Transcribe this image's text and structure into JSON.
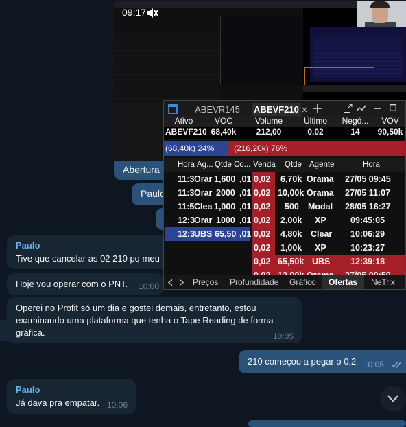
{
  "screenshot_thumb": {
    "time": "09:17"
  },
  "messages_out_partial": [
    {
      "text": "Abertura S"
    },
    {
      "text": "Paulo"
    }
  ],
  "messages": [
    {
      "sender": "Paulo",
      "lines": [
        "Tive que cancelar as 02 210 pq meu P"
      ]
    },
    {
      "lines": [
        "Hoje vou operar com o PNT."
      ],
      "time": "10:00"
    },
    {
      "lines": [
        "Operei no Profit só um dia e gostei demais, entretanto, estou",
        "examinando uma plataforma que tenha o Tape Reading de forma",
        "gráfica."
      ],
      "time": "10:05"
    },
    {
      "lines": [
        "210 começou a pegar o 0,2"
      ],
      "time": "10:05",
      "outgoing": true
    },
    {
      "sender": "Paulo",
      "lines": [
        "Já dava pra empatar."
      ],
      "time": "10:06"
    }
  ],
  "profit_window": {
    "tabs": [
      "ABEVR145",
      "ABEVF210"
    ],
    "active_tab": "ABEVF210",
    "quote_headers": [
      "Ativo",
      "VOC",
      "Volume",
      "Último",
      "Negó...",
      "VOV"
    ],
    "quote_values": [
      "ABEVF210",
      "68,40k",
      "212,00",
      "0,02",
      "14",
      "90,50k"
    ],
    "buy_bar": "(68,40k) 24%",
    "sell_bar": "(216,20k) 76%",
    "book_headers": [
      "Hora",
      "Ag...",
      "Qtde",
      "Co...",
      "Venda",
      "Qtde",
      "Agente",
      "Hora"
    ],
    "bid_rows": [
      {
        "hora": "11:3",
        "agente": "Orar",
        "qtde": "1,600",
        "preco": ",01"
      },
      {
        "hora": "11:3",
        "agente": "Orar",
        "qtde": "2000",
        "preco": ",01"
      },
      {
        "hora": "11:5",
        "agente": "Clea",
        "qtde": "1,000",
        "preco": ",01"
      },
      {
        "hora": "12:3",
        "agente": "Orar",
        "qtde": "1000",
        "preco": ",01"
      },
      {
        "hora": "12:3",
        "agente": "UBS",
        "qtde": "65,50",
        "preco": ",01"
      }
    ],
    "ask_rows": [
      {
        "venda": "0,02",
        "qtde": "6,70k",
        "agente": "Orama",
        "hora": "27/05 09:45"
      },
      {
        "venda": "0,02",
        "qtde": "10,00k",
        "agente": "Orama",
        "hora": "27/05 11:07"
      },
      {
        "venda": "0,02",
        "qtde": "500",
        "agente": "Modal",
        "hora": "28/05 16:27"
      },
      {
        "venda": "0,02",
        "qtde": "2,00k",
        "agente": "XP",
        "hora": "09:45:05"
      },
      {
        "venda": "0,02",
        "qtde": "4,80k",
        "agente": "Clear",
        "hora": "10:06:29"
      },
      {
        "venda": "0,02",
        "qtde": "1,00k",
        "agente": "XP",
        "hora": "10:23:27"
      },
      {
        "venda": "0,02",
        "qtde": "65,50k",
        "agente": "UBS",
        "hora": "12:39:18"
      },
      {
        "venda": "0,02",
        "qtde": "12,90k",
        "agente": "Orama",
        "hora": "27/05 09:59"
      }
    ],
    "bottom_tabs": [
      "Preços",
      "Profundidade",
      "Gráfico",
      "Ofertas",
      "NeTrix"
    ],
    "active_bottom_tab": "Ofertas"
  },
  "colors": {
    "background": "#0e1621",
    "incoming_bubble": "#182533",
    "outgoing_bubble": "#2b5278",
    "sender_name": "#64b5ef",
    "sell_red": "#a51f29",
    "buy_blue": "#2c4494"
  },
  "icons": [
    "volume-icon",
    "double-check-icon",
    "chevron-down-icon",
    "bookmark-icon",
    "plus-icon",
    "popout-icon",
    "chart-icon",
    "minimize-icon",
    "maximize-icon",
    "close-icon",
    "arrow-left-icon",
    "arrow-right-icon"
  ]
}
